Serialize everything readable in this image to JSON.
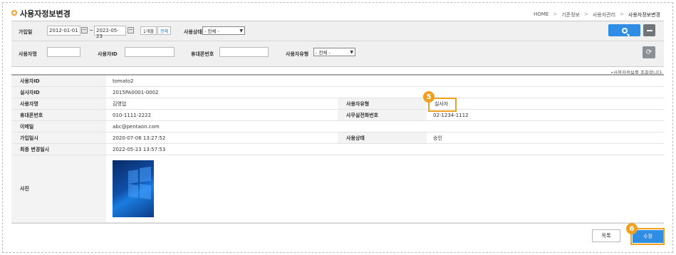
{
  "page": {
    "title": "사용자정보변경",
    "breadcrumb": [
      "HOME",
      "기준정보",
      "사용자관리",
      "사용자정보변경"
    ]
  },
  "search": {
    "join_date_label": "가입일",
    "date_from": "2012-01-01",
    "date_tilde": "~",
    "date_to": "2022-05-23",
    "btn_1month": "1개월",
    "btn_all": "전체",
    "status_label": "사용상태",
    "status_value": "- 전체 -",
    "name_label": "사용자명",
    "name_value": "",
    "id_label": "사용자ID",
    "id_value": "",
    "phone_label": "휴대폰번호",
    "phone_value": "",
    "type_label": "사용자유형",
    "type_value": "- 전체 -",
    "search_icon": "search-icon",
    "collapse_icon": "minus-icon",
    "refresh_icon": "refresh-icon"
  },
  "notice": "•사용자정보를 조회합니다.",
  "detail": {
    "user_id_label": "사용자ID",
    "user_id": "tomato2",
    "real_user_id_label": "실사자ID",
    "real_user_id": "2015PA0001-0002",
    "user_name_label": "사용자명",
    "user_name": "김영업",
    "user_type_label": "사용자유형",
    "user_type": "실사자",
    "mobile_label": "휴대폰번호",
    "mobile": "010-1111-2222",
    "office_phone_label": "사무실전화번호",
    "office_phone": "02-1234-1112",
    "email_label": "이메일",
    "email": "abc@pentaon.com",
    "join_date_label": "가입일시",
    "join_date": "2020-07-06 13:27:52",
    "status_label": "사용상태",
    "status": "승인",
    "last_modified_label": "최종 변경일시",
    "last_modified": "2022-05-23 13:57:53",
    "photo_label": "사진"
  },
  "callouts": {
    "five": "5",
    "six": "6"
  },
  "buttons": {
    "list": "목록",
    "edit": "수정"
  },
  "colors": {
    "accent_blue": "#2f8de4",
    "callout_orange": "#f0a020"
  }
}
